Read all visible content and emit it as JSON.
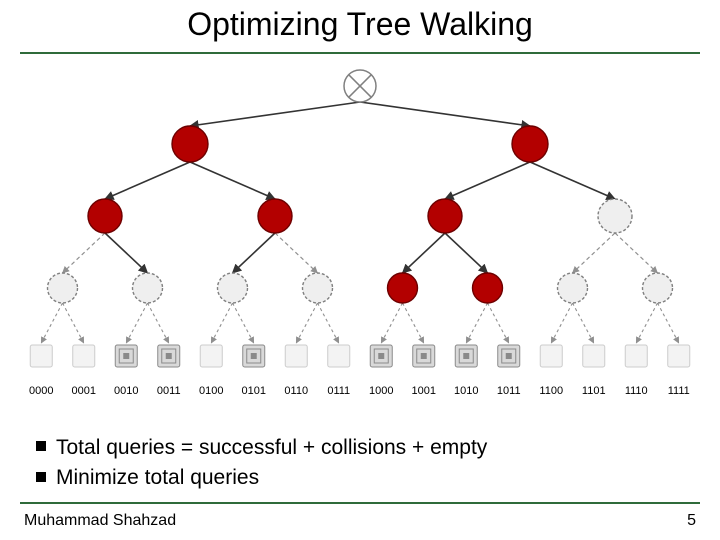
{
  "title": "Optimizing Tree Walking",
  "bullets": [
    "Total queries = successful + collisions + empty",
    "Minimize total queries"
  ],
  "footer": {
    "author": "Muhammad Shahzad",
    "page": "5"
  },
  "colors": {
    "collision": "#B30000",
    "empty": "#EFEFEF",
    "stroke": "#808080",
    "dashed_stroke": "#909090",
    "rule": "#2f6b3a"
  },
  "tree": {
    "levels": 4,
    "solid_edges": [
      [
        0,
        0,
        1,
        0
      ],
      [
        0,
        0,
        1,
        1
      ],
      [
        1,
        0,
        2,
        0
      ],
      [
        1,
        0,
        2,
        1
      ],
      [
        1,
        1,
        2,
        2
      ],
      [
        1,
        1,
        2,
        3
      ],
      [
        2,
        0,
        3,
        1
      ],
      [
        2,
        1,
        3,
        2
      ],
      [
        2,
        2,
        3,
        4
      ],
      [
        2,
        2,
        3,
        5
      ]
    ],
    "dashed_edges": [
      [
        2,
        0,
        3,
        0
      ],
      [
        2,
        1,
        3,
        3
      ],
      [
        2,
        3,
        3,
        6
      ],
      [
        2,
        3,
        3,
        7
      ]
    ],
    "collision_nodes": {
      "1": [
        0,
        1
      ],
      "2": [
        0,
        1,
        2
      ],
      "3": [
        4,
        5
      ]
    },
    "empty_internal_nodes": {
      "2": [
        3
      ],
      "3": [
        0,
        1,
        2,
        3,
        6,
        7
      ]
    },
    "root": "cross",
    "leaves": {
      "count": 16,
      "dashed_from_parent": true,
      "present_tag_indices": [
        2,
        3,
        5,
        8,
        9,
        10,
        11
      ],
      "labels_binary_bits": 4
    }
  }
}
